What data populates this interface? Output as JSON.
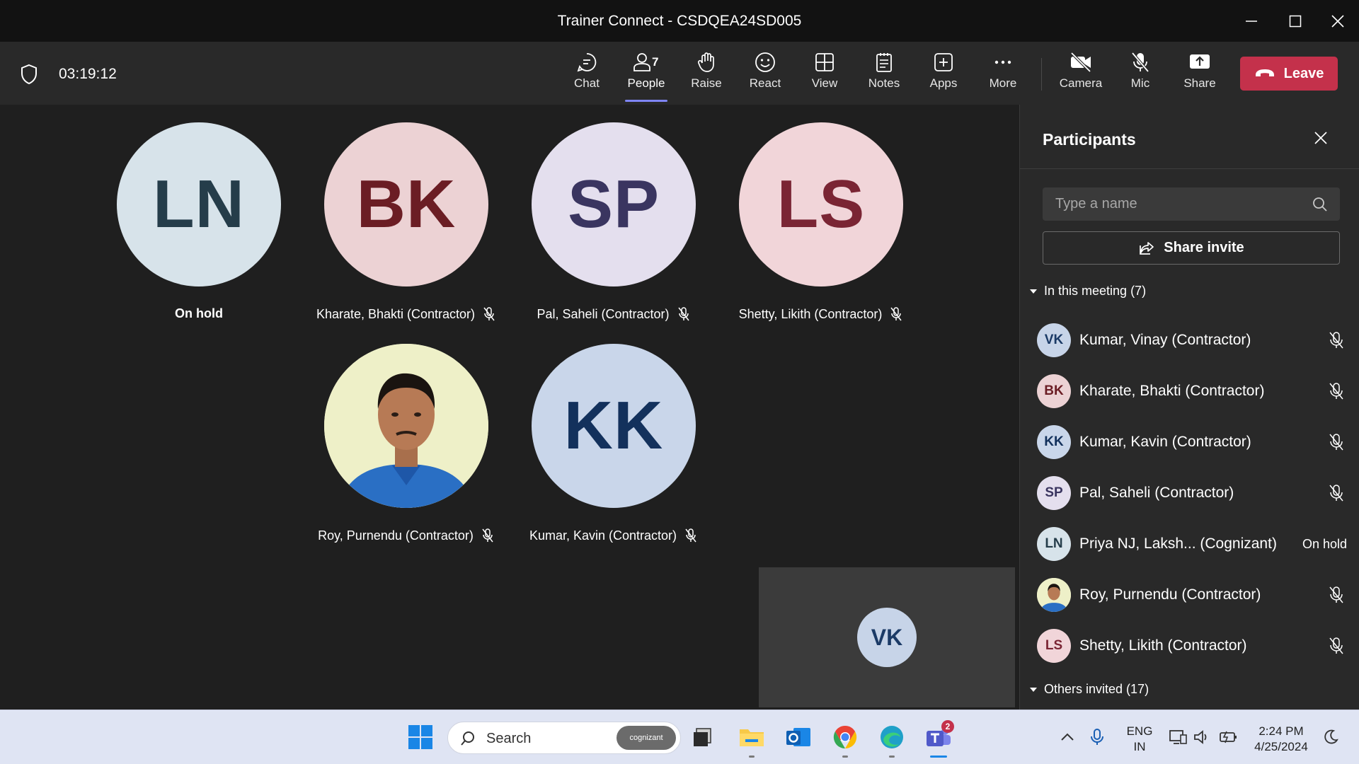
{
  "window": {
    "title": "Trainer Connect - CSDQEA24SD005"
  },
  "toolbar": {
    "timer": "03:19:12",
    "buttons": {
      "chat": "Chat",
      "people": "People",
      "people_count": "7",
      "raise": "Raise",
      "react": "React",
      "view": "View",
      "notes": "Notes",
      "apps": "Apps",
      "more": "More",
      "camera": "Camera",
      "mic": "Mic",
      "share": "Share"
    },
    "leave": "Leave"
  },
  "stage": {
    "tiles": [
      {
        "initials": "LN",
        "name": "On hold",
        "bg": "#d7e3ea",
        "fg": "#253d4a"
      },
      {
        "initials": "BK",
        "name": "Kharate, Bhakti (Contractor)",
        "bg": "#ecd2d4",
        "fg": "#6b1d24"
      },
      {
        "initials": "SP",
        "name": "Pal, Saheli (Contractor)",
        "bg": "#e4dfee",
        "fg": "#3a3560"
      },
      {
        "initials": "LS",
        "name": "Shetty, Likith (Contractor)",
        "bg": "#f1d5d9",
        "fg": "#7a2534"
      },
      {
        "initials": "",
        "name": "Roy, Purnendu (Contractor)",
        "bg": "#2f6fb5",
        "fg": "#ffffff"
      },
      {
        "initials": "KK",
        "name": "Kumar, Kavin (Contractor)",
        "bg": "#c9d6ea",
        "fg": "#13315c"
      }
    ],
    "self_view": {
      "initials": "VK"
    }
  },
  "panel": {
    "title": "Participants",
    "search_placeholder": "Type a name",
    "share_invite": "Share invite",
    "in_meeting_label": "In this meeting (7)",
    "others_invited_label": "Others invited (17)",
    "participants": [
      {
        "initials": "VK",
        "name": "Kumar, Vinay (Contractor)",
        "status": "",
        "bg": "#c7d4e8",
        "fg": "#1b3a66"
      },
      {
        "initials": "BK",
        "name": "Kharate, Bhakti (Contractor)",
        "status": "",
        "bg": "#ecd2d4",
        "fg": "#6b1d24"
      },
      {
        "initials": "KK",
        "name": "Kumar, Kavin (Contractor)",
        "status": "",
        "bg": "#c9d6ea",
        "fg": "#13315c"
      },
      {
        "initials": "SP",
        "name": "Pal, Saheli (Contractor)",
        "status": "",
        "bg": "#e4dfee",
        "fg": "#3a3560"
      },
      {
        "initials": "LN",
        "name": "Priya NJ, Laksh... (Cognizant)",
        "status": "On hold",
        "bg": "#d7e3ea",
        "fg": "#253d4a"
      },
      {
        "initials": "",
        "name": "Roy, Purnendu (Contractor)",
        "status": "",
        "bg": "#2f6fb5",
        "fg": "#ffffff"
      },
      {
        "initials": "LS",
        "name": "Shetty, Likith (Contractor)",
        "status": "",
        "bg": "#f1d5d9",
        "fg": "#7a2534"
      }
    ]
  },
  "taskbar": {
    "search_label": "Search",
    "search_badge": "cognizant",
    "teams_badge": "2",
    "lang_top": "ENG",
    "lang_bottom": "IN",
    "time": "2:24 PM",
    "date": "4/25/2024"
  }
}
